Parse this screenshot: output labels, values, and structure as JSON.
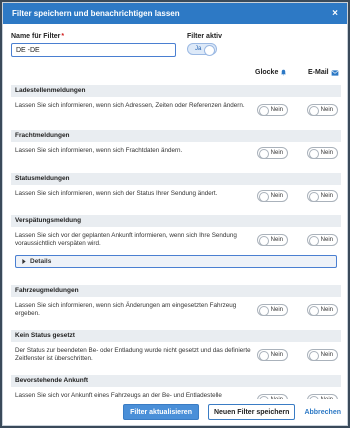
{
  "dialog": {
    "title": "Filter speichern und benachrichtigen lassen",
    "close": "×"
  },
  "form": {
    "filter_label": "Name für Filter",
    "required_mark": "*",
    "filter_value": "DE -DE",
    "active_label": "Filter aktiv",
    "active_toggle": "Ja"
  },
  "columns": {
    "bell": "Glocke",
    "email": "E-Mail"
  },
  "toggle_off": "Nein",
  "sections": [
    {
      "title": "Ladestellenmeldungen",
      "desc": "Lassen Sie sich informieren, wenn sich Adressen, Zeiten oder Referenzen ändern."
    },
    {
      "title": "Frachtmeldungen",
      "desc": "Lassen Sie sich informieren, wenn sich Frachtdaten ändern."
    },
    {
      "title": "Statusmeldungen",
      "desc": "Lassen Sie sich informieren, wenn sich der Status Ihrer Sendung ändert."
    },
    {
      "title": "Verspätungsmeldung",
      "desc": "Lassen Sie sich vor der geplanten Ankunft informieren, wenn sich Ihre Sendung voraussichtlich verspäten wird.",
      "details": "Details"
    },
    {
      "title": "Fahrzeugmeldungen",
      "desc": "Lassen Sie sich informieren, wenn sich Änderungen am eingesetzten Fahrzeug ergeben."
    },
    {
      "title": "Kein Status gesetzt",
      "desc": "Der Status zur beendeten Be- oder Entladung wurde nicht gesetzt und das definierte Zeitfenster ist überschritten."
    },
    {
      "title": "Bevorstehende Ankunft",
      "desc": "Lassen Sie sich vor Ankunft eines Fahrzeugs an der Be- und Entladestelle"
    }
  ],
  "footer": {
    "update": "Filter aktualisieren",
    "new": "Neuen Filter speichern",
    "cancel": "Abbrechen"
  },
  "colors": {
    "header": "#2d79c5",
    "section": "#e9edf1",
    "accent": "#4a8fd8"
  }
}
